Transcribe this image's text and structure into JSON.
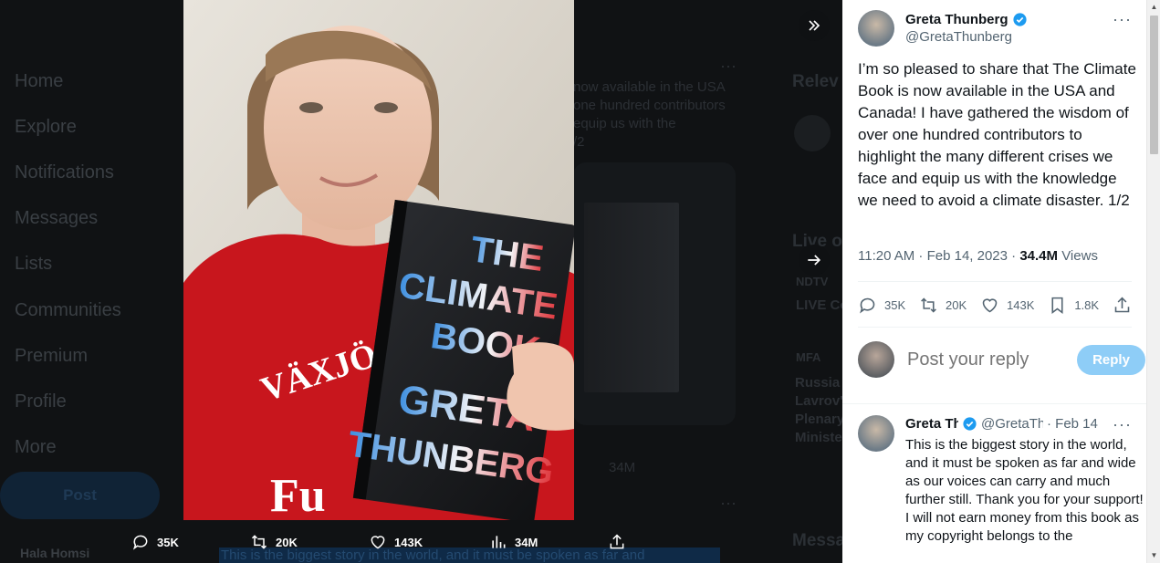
{
  "background": {
    "nav_items": [
      "Home",
      "Explore",
      "Notifications",
      "Messages",
      "Lists",
      "Communities",
      "Premium",
      "Profile",
      "More"
    ],
    "post_label": "Post",
    "account_name": "Hala Homsi",
    "bg_text_lines": [
      "now available in the USA",
      "one hundred contributors",
      "equip us with the",
      "/2"
    ],
    "right_heading_1": "Relev",
    "right_heading_2": "Live o",
    "right_heading_3": "Messa",
    "right_news_1": "NDTV",
    "right_news_2": "LIVE Co",
    "right_news_3": "MFA",
    "right_news_4": [
      "Russia",
      "Lavrov'",
      "Plenary",
      "Ministe"
    ],
    "bg_views": "34M",
    "highlight_text": "This is the biggest story in the world, and it must be spoken as far and"
  },
  "photo": {
    "book_lines": [
      "THE",
      "CLIMATE",
      "BOOK",
      "GRETA",
      "THUNBERG"
    ],
    "shirt_text_1": "VÄXJÖ",
    "shirt_text_2": "Fu"
  },
  "photo_actions": {
    "replies": "35K",
    "reposts": "20K",
    "likes": "143K",
    "views": "34M"
  },
  "tweet": {
    "author_name": "Greta Thunberg",
    "author_handle": "@GretaThunberg",
    "text": "I’m so pleased to share that The Climate Book is now available in the USA and Canada! I have gathered the wisdom of over one hundred contributors to highlight the many different crises we face and equip us with the knowledge we need to avoid a climate disaster. 1/2",
    "time": "11:20 AM · Feb 14, 2023 · ",
    "views": "34.4M",
    "views_label": " Views",
    "replies": "35K",
    "reposts": "20K",
    "likes": "143K",
    "bookmarks": "1.8K"
  },
  "reply": {
    "placeholder": "Post your reply",
    "button": "Reply"
  },
  "reply_tweet": {
    "name": "Greta Thunberg",
    "handle": "@GretaThunberg",
    "date": "· Feb 14",
    "text_1": "This is the biggest story in the world, and it must be spoken as far and wide as our voices can carry and much further still. Thank you for your support!",
    "text_2": "I will not earn money from this book as my copyright belongs to the"
  },
  "colors": {
    "accent": "#1d9bf0",
    "reply_button": "#8ecdf7",
    "shirt_red": "#c8161d"
  }
}
